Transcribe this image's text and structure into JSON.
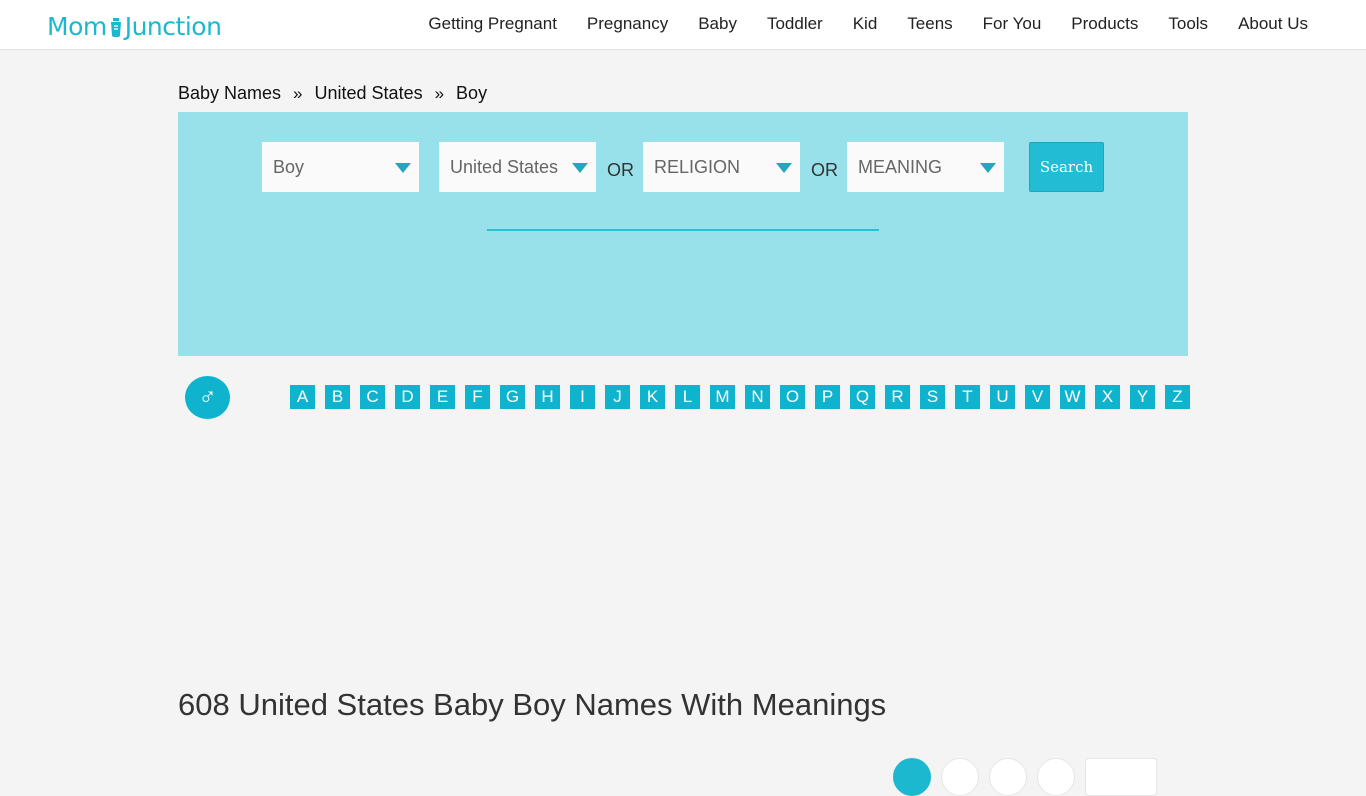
{
  "header": {
    "logo_left": "Mom",
    "logo_right": "Junction",
    "nav": [
      "Getting Pregnant",
      "Pregnancy",
      "Baby",
      "Toddler",
      "Kid",
      "Teens",
      "For You",
      "Products",
      "Tools",
      "About Us"
    ]
  },
  "breadcrumb": {
    "items": [
      "Baby Names",
      "United States",
      "Boy"
    ],
    "separator": "»"
  },
  "search": {
    "gender": "Boy",
    "origin": "United States",
    "or_label": "OR",
    "religion": "RELIGION",
    "meaning": "MEANING",
    "button": "Search"
  },
  "gender_symbol": "♂",
  "alphabet": [
    "A",
    "B",
    "C",
    "D",
    "E",
    "F",
    "G",
    "H",
    "I",
    "J",
    "K",
    "L",
    "M",
    "N",
    "O",
    "P",
    "Q",
    "R",
    "S",
    "T",
    "U",
    "V",
    "W",
    "X",
    "Y",
    "Z"
  ],
  "page_title": "608 United States Baby Boy Names With Meanings",
  "colors": {
    "accent": "#1cb8cf",
    "panel": "#98e1ea"
  }
}
